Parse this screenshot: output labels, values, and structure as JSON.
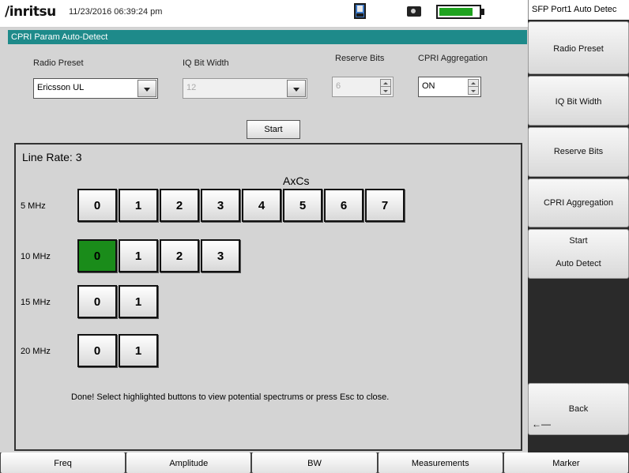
{
  "header": {
    "brand": "/inritsu",
    "datetime": "11/23/2016 06:39:24 pm",
    "battery_level": 0.85,
    "icons": [
      "save-icon",
      "camera-icon",
      "battery-icon"
    ]
  },
  "right_panel": {
    "title": "SFP Port1 Auto Detec",
    "softkeys": {
      "radio_preset": "Radio Preset",
      "iq_bit_width": "IQ Bit Width",
      "reserve_bits": "Reserve Bits",
      "cpri_aggregation": "CPRI Aggregation",
      "start_line1": "Start",
      "start_line2": "Auto Detect",
      "back": "Back"
    }
  },
  "bottom_tabs": [
    "Freq",
    "Amplitude",
    "BW",
    "Measurements",
    "Marker"
  ],
  "dialog": {
    "title": "CPRI Param Auto-Detect",
    "radio_preset": {
      "label": "Radio Preset",
      "value": "Ericsson UL"
    },
    "iq_bit_width": {
      "label": "IQ Bit Width",
      "value": "12"
    },
    "reserve_bits": {
      "label": "Reserve Bits",
      "value": "6"
    },
    "cpri_aggregation": {
      "label": "CPRI Aggregation",
      "value": "ON"
    },
    "start_label": "Start"
  },
  "results": {
    "line_rate": "Line Rate: 3",
    "axcs_title": "AxCs",
    "rows": [
      {
        "label": "5 MHz",
        "buttons": [
          "0",
          "1",
          "2",
          "3",
          "4",
          "5",
          "6",
          "7"
        ],
        "active": []
      },
      {
        "label": "10 MHz",
        "buttons": [
          "0",
          "1",
          "2",
          "3"
        ],
        "active": [
          "0"
        ]
      },
      {
        "label": "15 MHz",
        "buttons": [
          "0",
          "1"
        ],
        "active": []
      },
      {
        "label": "20 MHz",
        "buttons": [
          "0",
          "1"
        ],
        "active": []
      }
    ],
    "message": "Done! Select highlighted buttons to view potential spectrums or press Esc to close."
  },
  "colors": {
    "title_bar": "#1e8a8a",
    "active_button": "#1a8c1a",
    "battery": "#1fa31f"
  }
}
